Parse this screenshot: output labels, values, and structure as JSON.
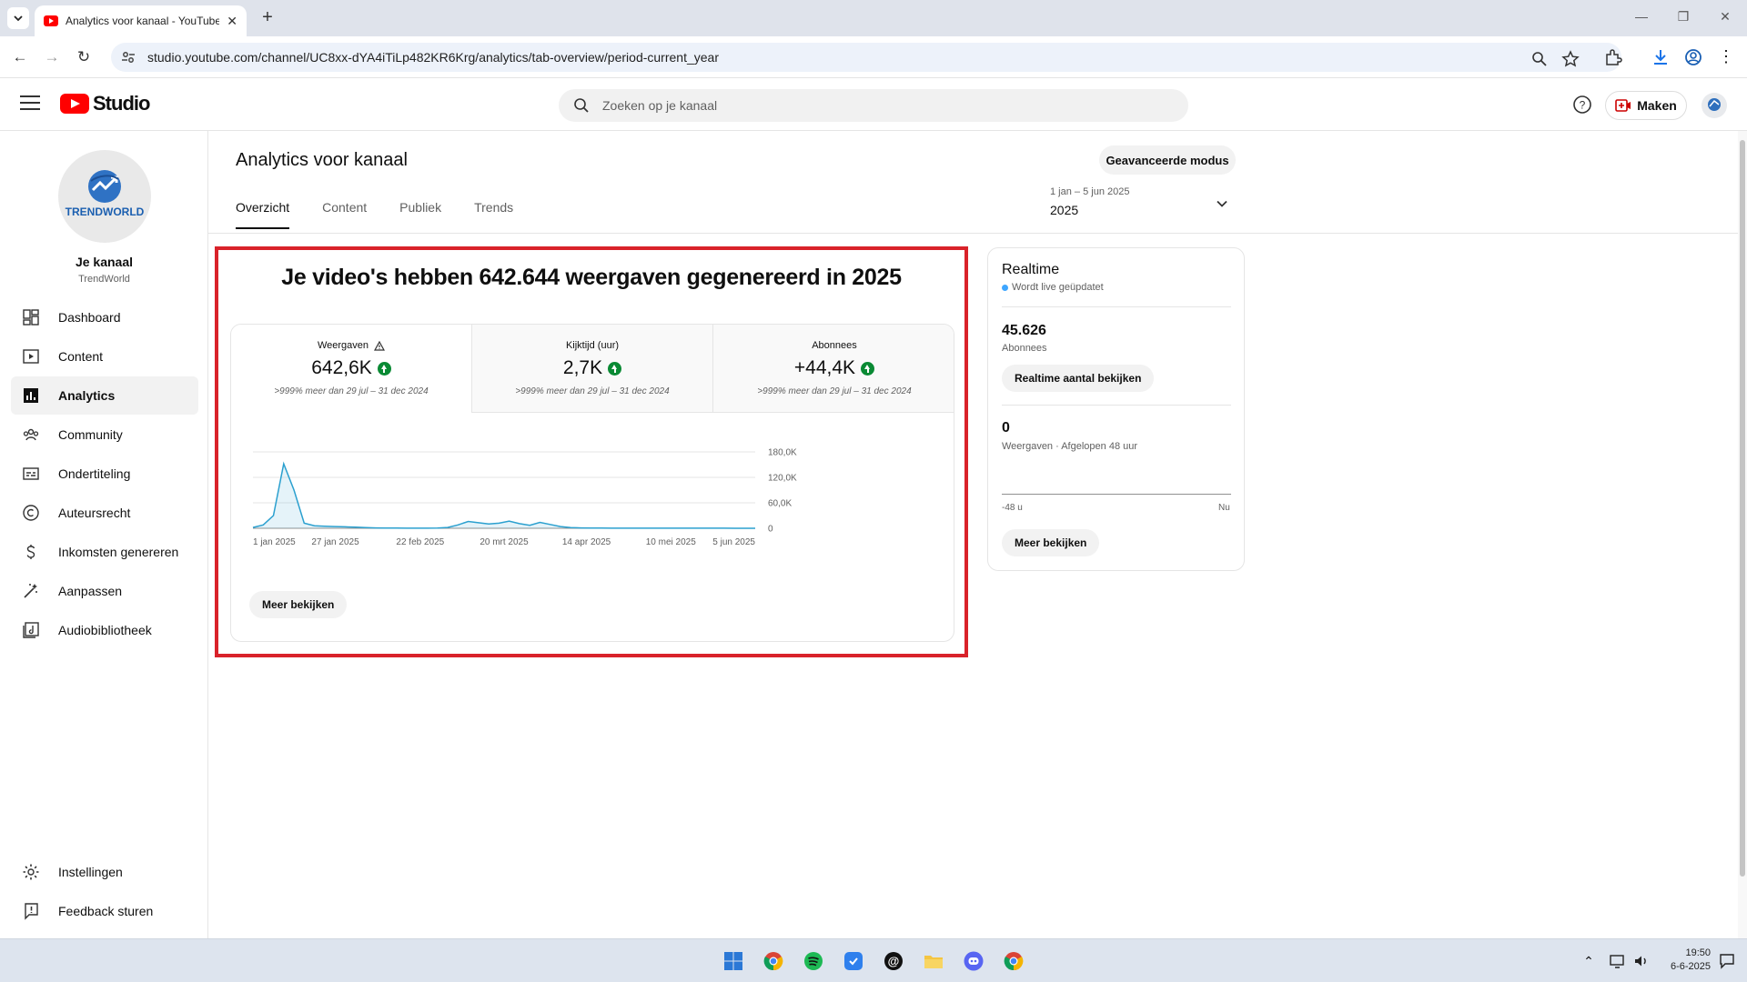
{
  "browser": {
    "tab_title": "Analytics voor kanaal - YouTube Studio",
    "url": "studio.youtube.com/channel/UC8xx-dYA4iTiLp482KR6Krg/analytics/tab-overview/period-current_year"
  },
  "header": {
    "logo_text": "Studio",
    "search_placeholder": "Zoeken op je kanaal",
    "create_label": "Maken"
  },
  "sidebar": {
    "avatar_text": "TRENDWORLD",
    "channel_title": "Je kanaal",
    "channel_handle": "TrendWorld",
    "items": [
      {
        "label": "Dashboard",
        "icon": "dashboard-icon"
      },
      {
        "label": "Content",
        "icon": "content-icon"
      },
      {
        "label": "Analytics",
        "icon": "analytics-icon",
        "active": true
      },
      {
        "label": "Community",
        "icon": "community-icon"
      },
      {
        "label": "Ondertiteling",
        "icon": "subtitles-icon"
      },
      {
        "label": "Auteursrecht",
        "icon": "copyright-icon"
      },
      {
        "label": "Inkomsten genereren",
        "icon": "monetization-icon"
      },
      {
        "label": "Aanpassen",
        "icon": "customize-icon"
      },
      {
        "label": "Audiobibliotheek",
        "icon": "audio-library-icon"
      }
    ],
    "bottom_items": [
      {
        "label": "Instellingen",
        "icon": "settings-icon"
      },
      {
        "label": "Feedback sturen",
        "icon": "feedback-icon"
      }
    ]
  },
  "main": {
    "title": "Analytics voor kanaal",
    "advanced_button": "Geavanceerde modus",
    "tabs": [
      "Overzicht",
      "Content",
      "Publiek",
      "Trends"
    ],
    "active_tab": "Overzicht",
    "date_range": "1 jan – 5 jun 2025",
    "date_label": "2025",
    "headline": "Je video's hebben 642.644 weergaven gegenereerd in 2025",
    "metrics": [
      {
        "label": "Weergaven",
        "value": "642,6K",
        "compare": ">999% meer dan 29 jul – 31 dec 2024",
        "warning": true
      },
      {
        "label": "Kijktijd (uur)",
        "value": "2,7K",
        "compare": ">999% meer dan 29 jul – 31 dec 2024"
      },
      {
        "label": "Abonnees",
        "value": "+44,4K",
        "compare": ">999% meer dan 29 jul – 31 dec 2024"
      }
    ],
    "more_button": "Meer bekijken"
  },
  "chart_data": {
    "type": "area",
    "series": [
      {
        "values": [
          2000,
          8000,
          30000,
          152000,
          90000,
          12000,
          6000,
          5000,
          4000,
          3500,
          2500,
          1500,
          800,
          500,
          400,
          300,
          300,
          300,
          400,
          2000,
          8000,
          16000,
          13000,
          10000,
          12000,
          17000,
          11000,
          7000,
          14000,
          9000,
          4000,
          1500,
          900,
          500,
          400,
          300,
          250,
          250,
          200,
          200,
          180,
          160,
          150,
          140,
          130,
          120,
          110,
          100,
          100,
          100
        ]
      }
    ],
    "x_ticks": [
      "1 jan 2025",
      "27 jan 2025",
      "22 feb 2025",
      "20 mrt 2025",
      "14 apr 2025",
      "10 mei 2025",
      "5 jun 2025"
    ],
    "y_ticks": [
      "180,0K",
      "120,0K",
      "60,0K",
      "0"
    ],
    "ylim": [
      0,
      180000
    ],
    "grid": true,
    "color": "#2ba0cf"
  },
  "realtime": {
    "title": "Realtime",
    "live_text": "Wordt live geüpdatet",
    "subscribers_value": "45.626",
    "subscribers_label": "Abonnees",
    "subscribers_button": "Realtime aantal bekijken",
    "views_value": "0",
    "views_label": "Weergaven · Afgelopen 48 uur",
    "axis_start": "-48 u",
    "axis_end": "Nu",
    "more_button": "Meer bekijken"
  },
  "taskbar": {
    "time": "19:50",
    "date": "6-6-2025"
  },
  "colors": {
    "youtube_red": "#ff0000",
    "highlight_red": "#d9222a",
    "positive_green": "#0a8a34",
    "chart_line": "#2ba0cf",
    "live_blue": "#3ea6ff"
  }
}
